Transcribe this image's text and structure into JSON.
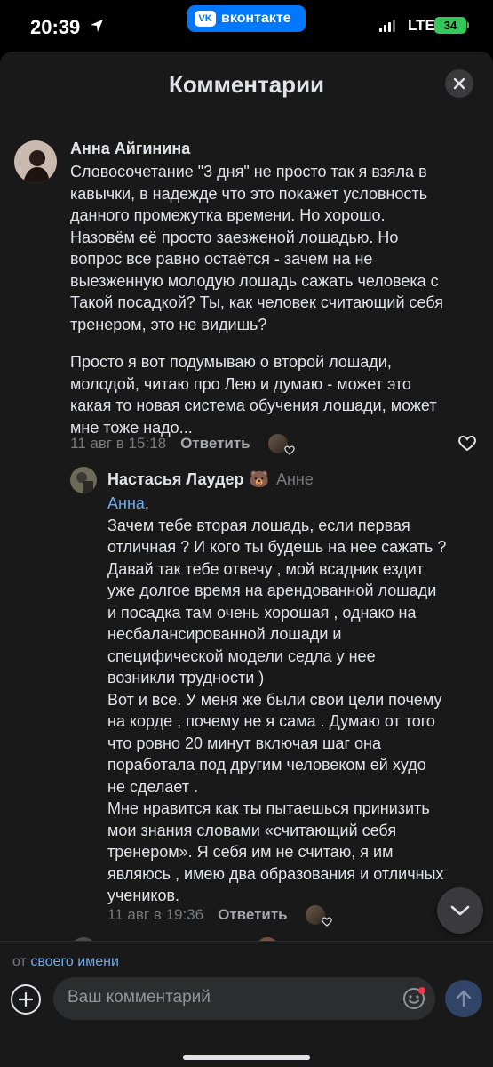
{
  "status": {
    "time": "20:39",
    "app_pill": "вконтакте",
    "network": "LTE",
    "battery": "34"
  },
  "header": {
    "title": "Комментарии"
  },
  "comments": [
    {
      "author": "Анна Айгинина",
      "paragraphs": [
        [
          "Словосочетание \"3 дня\" не просто так я взяла в",
          "кавычки, в надежде что это покажет условность",
          "данного промежутка времени.  Но хорошо.",
          "Назовём её просто заезженой лошадью. Но",
          "вопрос все равно остаётся - зачем на не",
          "выезженную молодую лошадь сажать человека с",
          "Такой посадкой? Ты, как человек считающий себя",
          "тренером, это не видишь?"
        ],
        [
          "Просто я вот подумываю о второй лошади,",
          "молодой, читаю про Лею и думаю - может это",
          "какая то новая система обучения лошади, может",
          "мне тоже надо..."
        ]
      ],
      "date": "11 авг в 15:18",
      "reply_label": "Ответить"
    },
    {
      "author": "Настасья Лаудер",
      "author_emoji": "🐻",
      "reply_to": "Анне",
      "mention": "Анна",
      "mention_suffix": ",",
      "lines": [
        "Зачем тебе вторая лошадь, если первая",
        "отличная ? И кого ты будешь на нее сажать ?",
        "Давай так тебе отвечу , мой всадник ездит",
        "уже долгое время на арендованной лошади",
        "и посадка там очень хорошая , однако на",
        "несбалансированной лошади и",
        "специфической модели седла у нее",
        "возникли трудности )",
        "Вот и все. У меня же были свои цели почему",
        "на корде , почему не я сама . Думаю от того",
        "что ровно 20 минут включая шаг она",
        "поработала под другим человеком ей худо",
        "не сделает .",
        "Мне нравится как ты пытаешься принизить",
        "мои знания словами «считающий себя",
        "тренером». Я себя им не считаю, я им",
        "являюсь , имею два образования и отличных",
        "учеников."
      ],
      "date": "11 авг в 19:36",
      "reply_label": "Ответить"
    }
  ],
  "composer": {
    "from_prefix": "от",
    "from_link": "своего имени",
    "placeholder": "Ваш комментарий"
  }
}
